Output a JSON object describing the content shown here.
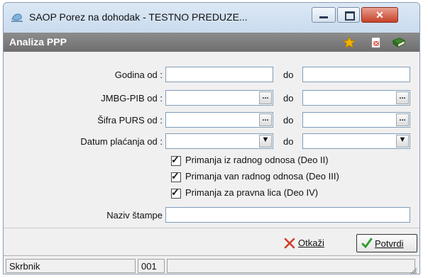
{
  "window": {
    "title": "SAOP Porez na dohodak - TESTNO PREDUZE..."
  },
  "header": {
    "title": "Analiza PPP"
  },
  "form": {
    "do": "do",
    "ellipsis": "...",
    "rows": [
      {
        "label": "Godina od :",
        "from": "",
        "to": ""
      },
      {
        "label": "JMBG-PIB  od :",
        "from": "",
        "to": ""
      },
      {
        "label": "Šifra PURS  od :",
        "from": "",
        "to": ""
      },
      {
        "label": "Datum plaćanja od :",
        "from": "",
        "to": ""
      }
    ],
    "checks": [
      {
        "label": "Primanja iz radnog odnosa (Deo II)",
        "checked": true
      },
      {
        "label": "Primanja van radnog odnosa (Deo III)",
        "checked": true
      },
      {
        "label": "Primanja za pravna lica (Deo IV)",
        "checked": true
      }
    ],
    "print_name": {
      "label": "Naziv štampe",
      "value": ""
    }
  },
  "actions": {
    "cancel": "Otkaži",
    "confirm": "Potvrdi"
  },
  "status": {
    "user": "Skrbnik",
    "code": "001"
  },
  "colors": {
    "header_bg": "#7a7a7a",
    "close_red": "#c7412b",
    "accent_star": "#f2b400"
  }
}
